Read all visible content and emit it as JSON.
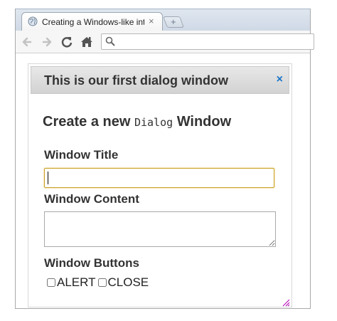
{
  "browser": {
    "tab": {
      "title": "Creating a Windows-like int",
      "close_glyph": "×",
      "icon": "globe-icon"
    },
    "new_tab_glyph": "+",
    "toolbar": {
      "back_icon": "back-arrow-icon",
      "forward_icon": "forward-arrow-icon",
      "reload_icon": "reload-icon",
      "home_icon": "home-icon",
      "search_icon": "search-icon",
      "address_value": ""
    }
  },
  "dialog": {
    "title": "This is our first dialog window",
    "close_glyph": "×",
    "form": {
      "heading_prefix": "Create a new",
      "heading_code": "Dialog",
      "heading_suffix": "Window",
      "window_title_label": "Window Title",
      "window_title_value": "",
      "window_content_label": "Window Content",
      "window_content_value": "",
      "window_buttons_label": "Window Buttons",
      "buttons": [
        {
          "label": "ALERT",
          "checked": false
        },
        {
          "label": "CLOSE",
          "checked": false
        }
      ]
    }
  },
  "colors": {
    "close_accent": "#1a77c8",
    "focused_input_border": "#c9a227",
    "resize_handle": "#b000b0"
  }
}
